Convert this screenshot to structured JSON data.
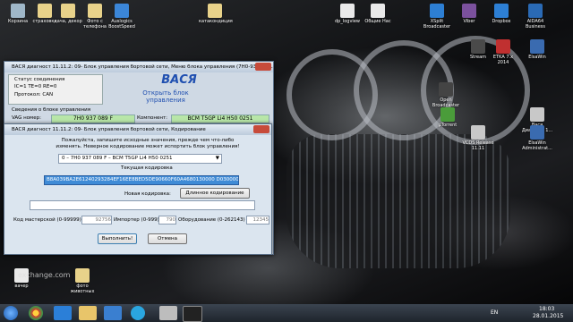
{
  "desktop_icons": [
    {
      "label": "Корзина",
      "color": "#9fb7c9",
      "icon": "recycle-bin-icon"
    },
    {
      "label": "страховка",
      "color": "#e8d28a",
      "icon": "folder-icon"
    },
    {
      "label": "дача, декор",
      "color": "#e8d28a",
      "icon": "folder-icon"
    },
    {
      "label": "Фото с телефона",
      "color": "#e8d28a",
      "icon": "folder-icon"
    },
    {
      "label": "Auslogics BoostSpeed",
      "color": "#3b86d8",
      "icon": "app-icon"
    },
    {
      "label": "катакондиция",
      "color": "#e8d28a",
      "icon": "folder-icon"
    },
    {
      "label": "dp_logview",
      "color": "#e9e9e9",
      "icon": "file-icon"
    },
    {
      "label": "Общие Нас",
      "color": "#e9e9e9",
      "icon": "file-icon"
    },
    {
      "label": "XSplit Broadcaster",
      "color": "#2d7fd4",
      "icon": "app-icon"
    },
    {
      "label": "Viber",
      "color": "#7b519d",
      "icon": "app-icon"
    },
    {
      "label": "Dropbox",
      "color": "#2d7fd4",
      "icon": "app-icon"
    },
    {
      "label": "AIDA64 Business",
      "color": "#2a6ab5",
      "icon": "app-icon"
    },
    {
      "label": "Stream",
      "color": "#4a4a4a",
      "icon": "app-icon"
    },
    {
      "label": "ETKA 7.x 2014",
      "color": "#c03030",
      "icon": "app-icon"
    },
    {
      "label": "ElsaWin",
      "color": "#3a6bb0",
      "icon": "app-icon"
    },
    {
      "label": "Open Broadcaster",
      "color": "#444",
      "icon": "app-icon"
    },
    {
      "label": "µTorrent",
      "color": "#4a9c3a",
      "icon": "app-icon"
    },
    {
      "label": "Вася Диагност 1...",
      "color": "#c8c8c8",
      "icon": "app-icon"
    },
    {
      "label": "VCDS Release 11.11",
      "color": "#c8c8c8",
      "icon": "app-icon"
    },
    {
      "label": "ElsaWin Administrat...",
      "color": "#3a6bb0",
      "icon": "app-icon"
    },
    {
      "label": "вачер",
      "color": "#e9e9e9",
      "icon": "file-icon"
    },
    {
      "label": "фото животных",
      "color": "#e8d28a",
      "icon": "folder-icon"
    }
  ],
  "watermark": "exchange.com",
  "main_window": {
    "title": "ВАСЯ диагност 11.11.2: 09- Блок управления бортовой сети,  Меню блока управления (7H0-937-08X...",
    "status_group": "Статус соединения",
    "status_line": "IC=1  TE=0   RE=0",
    "protocol": "Протокол: CAN",
    "brand": "ВАСЯ",
    "brand_sub": "Открыть блок управления",
    "info_group": "Сведения о блоке управления",
    "vag_label": "VAG номер:",
    "vag_value": "7H0 937 089 F",
    "component_label": "Компонент:",
    "component_value": "BCM T5GP Li4   H50 0251"
  },
  "dialog": {
    "title": "ВАСЯ диагност 11.11.2: 09- Блок управления бортовой сети,  Кодирование",
    "instruction": "Пожалуйста, запишите исходные значения, прежде чем что-либо изменять. Неверное кодирование может испортить блок управления!",
    "select_value": "0 – 7H0 937 089 F – BCM T5GP Li4  H50 0251",
    "current_label": "Текущая кодировка",
    "current_value": "B8A039BA2E61240293284EF16EE8BED5DE90660F60A4680130000 D030000",
    "new_label": "Новая кодировка:",
    "long_button": "Длинное кодирование",
    "master_label": "Код мастерской (0-99999)",
    "master_value": "92756",
    "importer_label": "Импортер (0-999)",
    "importer_value": "790",
    "equipment_label": "Оборудование (0-262143)",
    "equipment_value": "12345",
    "do_button": "Выполнить!",
    "cancel_button": "Отмена"
  },
  "taskbar": {
    "lang": "EN",
    "time": "18:03",
    "date": "28.01.2015"
  }
}
